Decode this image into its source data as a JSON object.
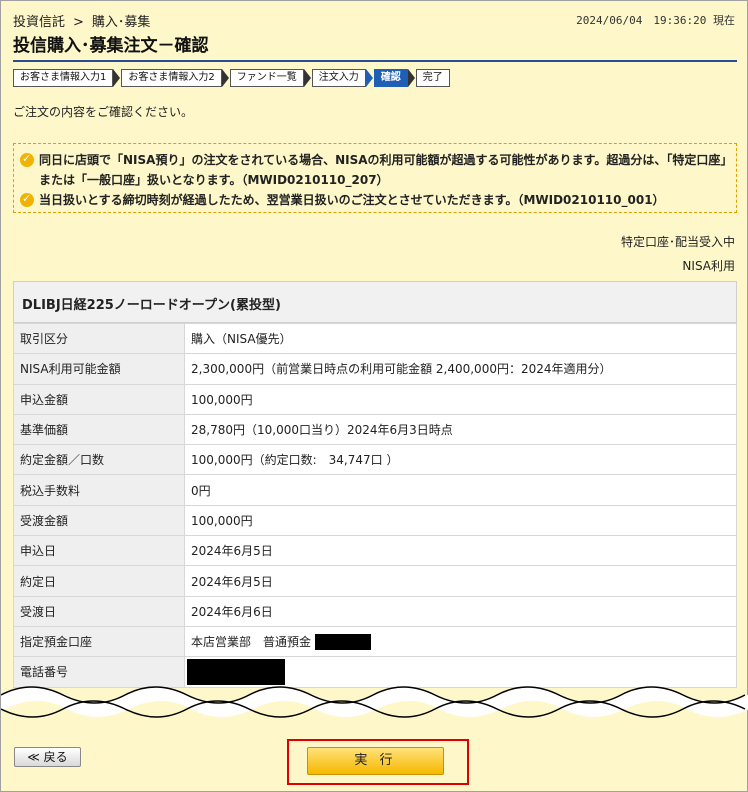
{
  "header": {
    "breadcrumb": [
      "投資信託",
      "購入･募集"
    ],
    "breadcrumb_sep": ">",
    "datetime": "2024/06/04　19:36:20 現在",
    "title": "投信購入･募集注文－確認"
  },
  "steps": [
    {
      "label": "お客さま情報入力1",
      "active": false
    },
    {
      "label": "お客さま情報入力2",
      "active": false
    },
    {
      "label": "ファンド一覧",
      "active": false
    },
    {
      "label": "注文入力",
      "active": false
    },
    {
      "label": "確認",
      "active": true
    },
    {
      "label": "完了",
      "active": false
    }
  ],
  "intro": "ご注文の内容をご確認ください。",
  "notices": [
    "同日に店頭で「NISA預り」の注文をされている場合、NISAの利用可能額が超過する可能性があります。超過分は、「特定口座」または「一般口座」扱いとなります。（MWID0210110_207）",
    "当日扱いとする締切時刻が経過したため、翌営業日扱いのご注文とさせていただきます。（MWID0210110_001）"
  ],
  "account_notes": [
    "特定口座･配当受入中",
    "NISA利用"
  ],
  "fund_name": "DLIBJ日経225ノーロードオープン(累投型)",
  "rows": [
    {
      "label": "取引区分",
      "value": "購入（NISA優先）"
    },
    {
      "label": "NISA利用可能金額",
      "value": "2,300,000円（前営業日時点の利用可能金額 2,400,000円：2024年適用分）"
    },
    {
      "label": "申込金額",
      "value": "100,000円"
    },
    {
      "label": "基準価額",
      "value": "28,780円（10,000口当り）2024年6月3日時点"
    },
    {
      "label": "約定金額／口数",
      "value": "100,000円（約定口数:　34,747口 ）"
    },
    {
      "label": "税込手数料",
      "value": "0円"
    },
    {
      "label": "受渡金額",
      "value": "100,000円"
    },
    {
      "label": "申込日",
      "value": "2024年6月5日"
    },
    {
      "label": "約定日",
      "value": "2024年6月5日"
    },
    {
      "label": "受渡日",
      "value": "2024年6月6日"
    },
    {
      "label": "指定預金口座",
      "value": "本店営業部　普通預金"
    },
    {
      "label": "電話番号",
      "value": ""
    }
  ],
  "buttons": {
    "back": "≪ 戻る",
    "execute": "実 行"
  },
  "colors": {
    "background": "#fdf7c9",
    "accent": "#1f5fb5",
    "execute": "#f6b800",
    "highlight": "#e00000",
    "warning": "#f1b300"
  }
}
